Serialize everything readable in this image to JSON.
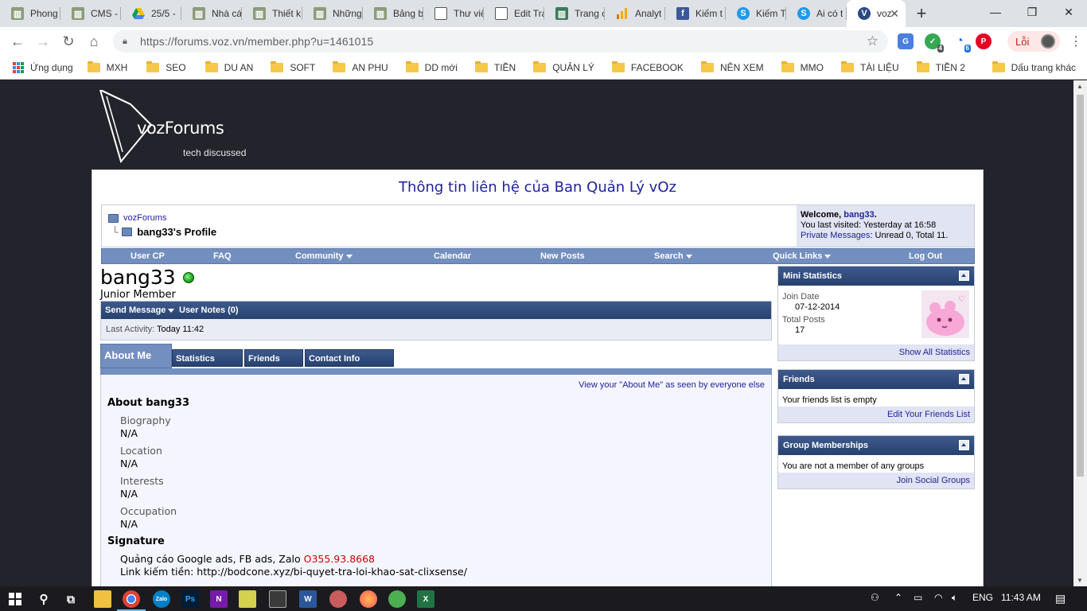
{
  "browser": {
    "tabs": [
      {
        "label": "Phong",
        "icon": "site-icon"
      },
      {
        "label": "CMS -",
        "icon": "site-icon"
      },
      {
        "label": "25/5 -",
        "icon": "google-drive-icon"
      },
      {
        "label": "Nhà cá",
        "icon": "site-icon"
      },
      {
        "label": "Thiết k",
        "icon": "site-icon"
      },
      {
        "label": "Những",
        "icon": "site-icon"
      },
      {
        "label": "Bảng b",
        "icon": "site-icon"
      },
      {
        "label": "Thư việ",
        "icon": "document-icon"
      },
      {
        "label": "Edit Tra",
        "icon": "document-icon"
      },
      {
        "label": "Trang c",
        "icon": "site-icon"
      },
      {
        "label": "Analyt",
        "icon": "analytics-icon"
      },
      {
        "label": "Kiếm t",
        "icon": "facebook-icon"
      },
      {
        "label": "Kiếm T",
        "icon": "skype-icon"
      },
      {
        "label": "Ai có t",
        "icon": "skype-icon"
      },
      {
        "label": "voz",
        "icon": "voz-icon"
      }
    ],
    "url": "https://forums.voz.vn/member.php?u=1461015",
    "profile_label": "Lỗi",
    "ext_badges": {
      "a": "4",
      "b": "6"
    },
    "bookmarks": [
      "MXH",
      "SEO",
      "DU AN",
      "SOFT",
      "AN PHU",
      "DD mới",
      "TIỀN",
      "QUẢN LÝ",
      "FACEBOOK",
      "NÊN XEM",
      "MMO",
      "TÀI LIỆU",
      "TIỀN 2"
    ],
    "apps_label": "Ứng dụng",
    "other_bookmarks": "Dấu trang khác"
  },
  "site": {
    "brand": "vozForums",
    "tagline": "tech discussed",
    "notice": "Thông tin liên hệ của Ban Quản Lý vOz",
    "breadcrumb_root": "vozForums",
    "breadcrumb_current": "bang33's Profile",
    "welcome": {
      "prefix": "Welcome,",
      "user": "bang33",
      "suffix": ".",
      "last_visited": "You last visited: Yesterday at 16:58",
      "pm_label": "Private Messages",
      "pm_value": ": Unread 0, Total 11."
    },
    "nav": [
      "User CP",
      "FAQ",
      "Community",
      "Calendar",
      "New Posts",
      "Search",
      "Quick Links",
      "Log Out"
    ]
  },
  "profile": {
    "username": "bang33",
    "user_title": "Junior Member",
    "send_message": "Send Message",
    "user_notes": "User Notes (0)",
    "last_activity_label": "Last Activity:",
    "last_activity_value": "Today 11:42",
    "tabs": [
      "About Me",
      "Statistics",
      "Friends",
      "Contact Info"
    ],
    "view_about_link": "View your \"About Me\" as seen by everyone else",
    "about_heading": "About bang33",
    "fields": [
      {
        "label": "Biography",
        "value": "N/A"
      },
      {
        "label": "Location",
        "value": "N/A"
      },
      {
        "label": "Interests",
        "value": "N/A"
      },
      {
        "label": "Occupation",
        "value": "N/A"
      }
    ],
    "signature_heading": "Signature",
    "signature_line1": "Quảng cáo Google ads, FB ads, Zalo",
    "signature_phone": "O355.93.8668",
    "signature_line2": "Link kiếm tiền: http://bodcone.xyz/bi-quyet-tra-loi-khao-sat-clixsense/"
  },
  "sidebar": {
    "mini_stats": {
      "title": "Mini Statistics",
      "join_label": "Join Date",
      "join_value": "07-12-2014",
      "posts_label": "Total Posts",
      "posts_value": "17",
      "footer": "Show All Statistics"
    },
    "friends": {
      "title": "Friends",
      "body": "Your friends list is empty",
      "footer": "Edit Your Friends List"
    },
    "groups": {
      "title": "Group Memberships",
      "body": "You are not a member of any groups",
      "footer": "Join Social Groups"
    }
  },
  "taskbar": {
    "language": "ENG",
    "time": "11:43 AM"
  },
  "colors": {
    "page_bg": "#23232b",
    "link": "#22229c",
    "nav_bar": "#738fbf",
    "header_dark": "#27426f",
    "welcome_bg": "#e1e4f2",
    "phone": "#cc0000"
  }
}
